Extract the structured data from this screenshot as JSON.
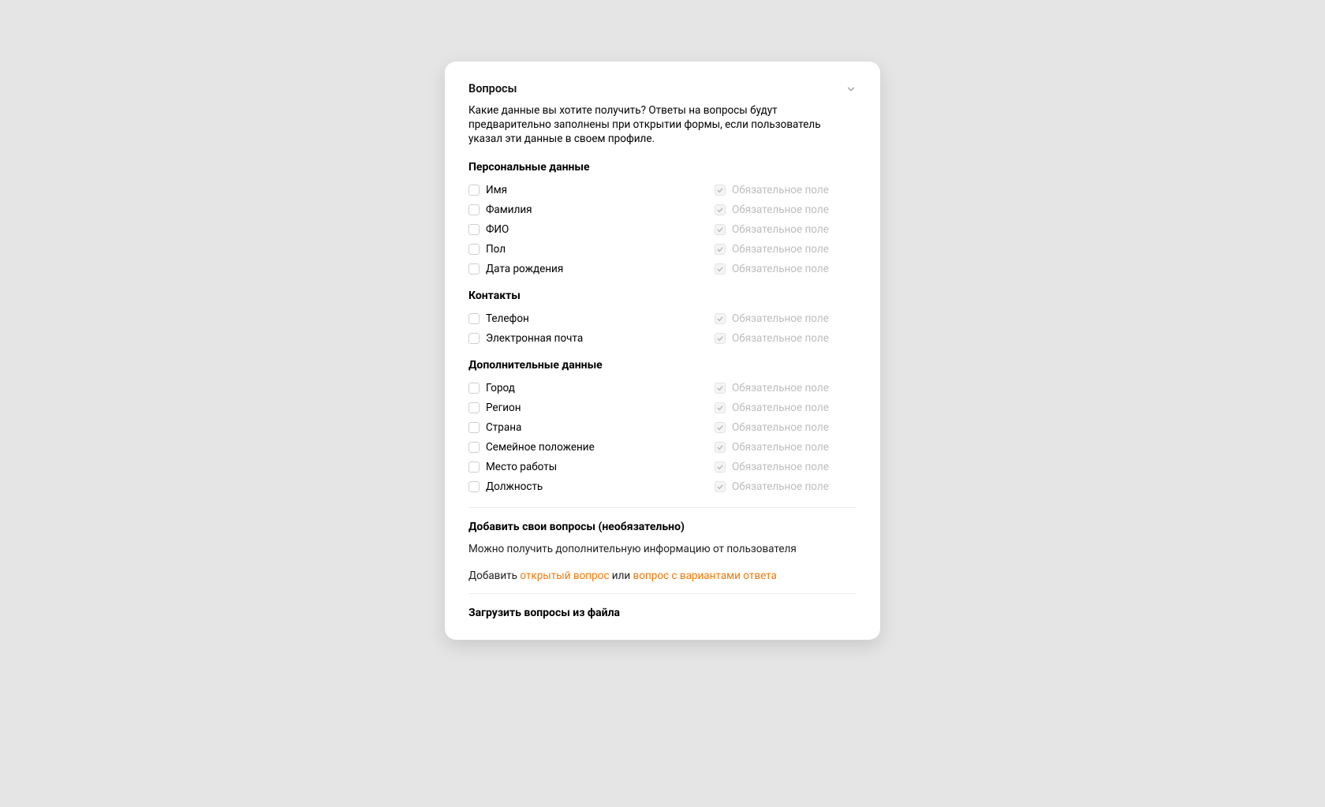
{
  "card": {
    "title": "Вопросы",
    "description": "Какие данные вы хотите получить? Ответы на вопросы будут предварительно заполнены при открытии формы, если пользователь указал эти данные в своем профиле.",
    "required_label": "Обязательное поле"
  },
  "groups": {
    "personal": {
      "title": "Персональные данные",
      "fields": {
        "firstname": "Имя",
        "lastname": "Фамилия",
        "fullname": "ФИО",
        "gender": "Пол",
        "birthdate": "Дата рождения"
      }
    },
    "contacts": {
      "title": "Контакты",
      "fields": {
        "phone": "Телефон",
        "email": "Электронная почта"
      }
    },
    "additional": {
      "title": "Дополнительные данные",
      "fields": {
        "city": "Город",
        "region": "Регион",
        "country": "Страна",
        "marital": "Семейное положение",
        "workplace": "Место работы",
        "position": "Должность"
      }
    }
  },
  "custom": {
    "title": "Добавить свои вопросы (необязательно)",
    "description": "Можно получить дополнительную информацию от пользователя",
    "prefix": "Добавить ",
    "open_link": "открытый вопрос",
    "or": " или ",
    "variant_link": "вопрос с вариантами ответа"
  },
  "upload": {
    "title": "Загрузить вопросы из файла"
  }
}
